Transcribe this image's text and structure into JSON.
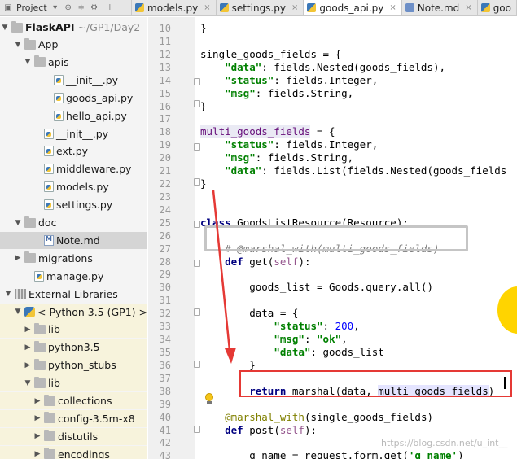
{
  "tabbar": {
    "project_label": "Project",
    "tabs": [
      {
        "label": "models.py",
        "icon": "python-file-icon",
        "active": false
      },
      {
        "label": "settings.py",
        "icon": "python-file-icon",
        "active": false
      },
      {
        "label": "goods_api.py",
        "icon": "python-file-icon",
        "active": true
      },
      {
        "label": "Note.md",
        "icon": "markdown-file-icon",
        "active": false
      },
      {
        "label": "goo",
        "icon": "python-file-icon",
        "active": false
      }
    ]
  },
  "tree": {
    "project_name": "FlaskAPI",
    "project_path": "~/GP1/Day2",
    "items": [
      {
        "label": "App",
        "depth": 1,
        "arrow": "down",
        "icon": "folder-icon"
      },
      {
        "label": "apis",
        "depth": 2,
        "arrow": "down",
        "icon": "folder-icon"
      },
      {
        "label": "__init__.py",
        "depth": 4,
        "arrow": "",
        "icon": "python-file-icon"
      },
      {
        "label": "goods_api.py",
        "depth": 4,
        "arrow": "",
        "icon": "python-file-icon"
      },
      {
        "label": "hello_api.py",
        "depth": 4,
        "arrow": "",
        "icon": "python-file-icon"
      },
      {
        "label": "__init__.py",
        "depth": 3,
        "arrow": "",
        "icon": "python-file-icon"
      },
      {
        "label": "ext.py",
        "depth": 3,
        "arrow": "",
        "icon": "python-file-icon"
      },
      {
        "label": "middleware.py",
        "depth": 3,
        "arrow": "",
        "icon": "python-file-icon"
      },
      {
        "label": "models.py",
        "depth": 3,
        "arrow": "",
        "icon": "python-file-icon"
      },
      {
        "label": "settings.py",
        "depth": 3,
        "arrow": "",
        "icon": "python-file-icon"
      },
      {
        "label": "doc",
        "depth": 1,
        "arrow": "down",
        "icon": "folder-icon"
      },
      {
        "label": "Note.md",
        "depth": 3,
        "arrow": "",
        "icon": "markdown-file-icon",
        "selected": true
      },
      {
        "label": "migrations",
        "depth": 1,
        "arrow": "right",
        "icon": "folder-icon"
      },
      {
        "label": "manage.py",
        "depth": 2,
        "arrow": "",
        "icon": "python-file-icon"
      },
      {
        "label": "External Libraries",
        "depth": 0,
        "arrow": "down",
        "icon": "external-libraries-icon"
      },
      {
        "label": "< Python 3.5 (GP1) >",
        "depth": 1,
        "arrow": "down",
        "icon": "python-sdk-icon",
        "lib": true
      },
      {
        "label": "lib",
        "depth": 2,
        "arrow": "right",
        "icon": "folder-icon",
        "lib": true
      },
      {
        "label": "python3.5",
        "depth": 2,
        "arrow": "right",
        "icon": "folder-icon",
        "lib": true
      },
      {
        "label": "python_stubs",
        "depth": 2,
        "arrow": "right",
        "icon": "folder-icon",
        "lib": true
      },
      {
        "label": "lib",
        "depth": 2,
        "arrow": "down",
        "icon": "folder-icon",
        "lib": true
      },
      {
        "label": "collections",
        "depth": 3,
        "arrow": "right",
        "icon": "folder-icon",
        "lib": true
      },
      {
        "label": "config-3.5m-x8",
        "depth": 3,
        "arrow": "right",
        "icon": "folder-icon",
        "lib": true
      },
      {
        "label": "distutils",
        "depth": 3,
        "arrow": "right",
        "icon": "folder-icon",
        "lib": true
      },
      {
        "label": "encodings",
        "depth": 3,
        "arrow": "right",
        "icon": "folder-icon",
        "lib": true
      }
    ]
  },
  "editor": {
    "line_numbers": [
      "10",
      "11",
      "12",
      "13",
      "14",
      "15",
      "16",
      "17",
      "18",
      "19",
      "20",
      "21",
      "22",
      "23",
      "24",
      "25",
      "26",
      "27",
      "28",
      "29",
      "30",
      "31",
      "32",
      "33",
      "34",
      "35",
      "36",
      "37",
      "38",
      "39",
      "40",
      "41",
      "42",
      "43"
    ],
    "lines": [
      [
        [
          "}",
          ""
        ]
      ],
      [],
      [
        [
          "single_goods_fields = {",
          ""
        ]
      ],
      [
        [
          "    ",
          ""
        ],
        [
          "\"data\"",
          "str"
        ],
        [
          ": fields.Nested(goods_fields),",
          ""
        ]
      ],
      [
        [
          "    ",
          ""
        ],
        [
          "\"status\"",
          "str"
        ],
        [
          ": fields.Integer,",
          ""
        ]
      ],
      [
        [
          "    ",
          ""
        ],
        [
          "\"msg\"",
          "str"
        ],
        [
          ": fields.String,",
          ""
        ]
      ],
      [
        [
          "}",
          ""
        ]
      ],
      [],
      [
        [
          "multi_goods_fields",
          "gvar"
        ],
        [
          " = {",
          ""
        ]
      ],
      [
        [
          "    ",
          ""
        ],
        [
          "\"status\"",
          "str"
        ],
        [
          ": fields.Integer,",
          ""
        ]
      ],
      [
        [
          "    ",
          ""
        ],
        [
          "\"msg\"",
          "str"
        ],
        [
          ": fields.String,",
          ""
        ]
      ],
      [
        [
          "    ",
          ""
        ],
        [
          "\"data\"",
          "str"
        ],
        [
          ": fields.List(fields.Nested(goods_fields",
          ""
        ]
      ],
      [
        [
          "}",
          ""
        ]
      ],
      [],
      [],
      [
        [
          "class",
          "kw"
        ],
        [
          " GoodsListResource(Resource):",
          ""
        ]
      ],
      [],
      [
        [
          "    ",
          ""
        ],
        [
          "# @marshal_with(multi_goods_fields)",
          "cmt"
        ]
      ],
      [
        [
          "    ",
          ""
        ],
        [
          "def",
          "kw"
        ],
        [
          " get(",
          ""
        ],
        [
          "self",
          "self"
        ],
        [
          "):",
          ""
        ]
      ],
      [],
      [
        [
          "        goods_list = Goods.query.all()",
          ""
        ]
      ],
      [],
      [
        [
          "        data = {",
          ""
        ]
      ],
      [
        [
          "            ",
          ""
        ],
        [
          "\"status\"",
          "str"
        ],
        [
          ": ",
          ""
        ],
        [
          "200",
          "num"
        ],
        [
          ",",
          ""
        ]
      ],
      [
        [
          "            ",
          ""
        ],
        [
          "\"msg\"",
          "str"
        ],
        [
          ": ",
          ""
        ],
        [
          "\"ok\"",
          "str"
        ],
        [
          ",",
          ""
        ]
      ],
      [
        [
          "            ",
          ""
        ],
        [
          "\"data\"",
          "str"
        ],
        [
          ": goods_list",
          ""
        ]
      ],
      [
        [
          "        }",
          ""
        ]
      ],
      [],
      [
        [
          "        ",
          ""
        ],
        [
          "return",
          "kw"
        ],
        [
          " marshal(data, ",
          ""
        ],
        [
          "multi_goods_fields",
          "hl"
        ],
        [
          ")",
          ""
        ]
      ],
      [],
      [
        [
          "    ",
          ""
        ],
        [
          "@marshal_with",
          "deco"
        ],
        [
          "(single_goods_fields)",
          ""
        ]
      ],
      [
        [
          "    ",
          ""
        ],
        [
          "def",
          "kw"
        ],
        [
          " post(",
          ""
        ],
        [
          "self",
          "self"
        ],
        [
          "):",
          ""
        ]
      ],
      [],
      [
        [
          "        g_name = request.form.get(",
          ""
        ],
        [
          "'g_name'",
          "str"
        ],
        [
          ")",
          ""
        ]
      ]
    ]
  },
  "watermark": "https://blog.csdn.net/u_int__",
  "annotation_colors": {
    "arrow": "#e53935",
    "red_box": "#e53935",
    "gray_box": "#c5c5c5",
    "blob": "#ffd400"
  }
}
